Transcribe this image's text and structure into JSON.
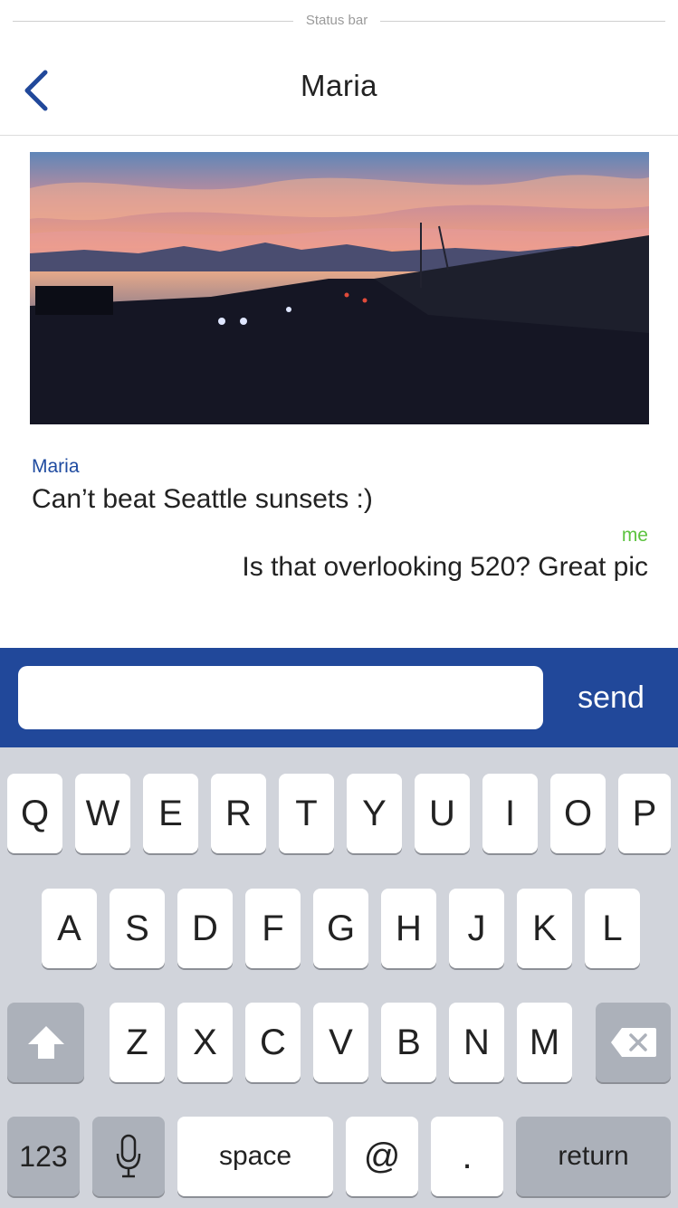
{
  "status_bar": {
    "label": "Status bar"
  },
  "header": {
    "title": "Maria"
  },
  "messages": [
    {
      "sender": "Maria",
      "text": "Can’t beat Seattle sunsets :)"
    },
    {
      "sender": "me",
      "text": "Is that overlooking 520? Great pic"
    }
  ],
  "composer": {
    "input_value": "",
    "placeholder": "",
    "send_label": "send"
  },
  "keyboard": {
    "row1": [
      "Q",
      "W",
      "E",
      "R",
      "T",
      "Y",
      "U",
      "I",
      "O",
      "P"
    ],
    "row2": [
      "A",
      "S",
      "D",
      "F",
      "G",
      "H",
      "J",
      "K",
      "L"
    ],
    "row3": [
      "Z",
      "X",
      "C",
      "V",
      "B",
      "N",
      "M"
    ],
    "numbers_label": "123",
    "space_label": "space",
    "at_label": "@",
    "period_label": ".",
    "return_label": "return"
  },
  "colors": {
    "accent": "#21489a",
    "maria_name": "#1f4ba0",
    "me_name": "#5cc33f",
    "keyboard_bg": "#d1d4db",
    "dark_key": "#acb1ba"
  }
}
